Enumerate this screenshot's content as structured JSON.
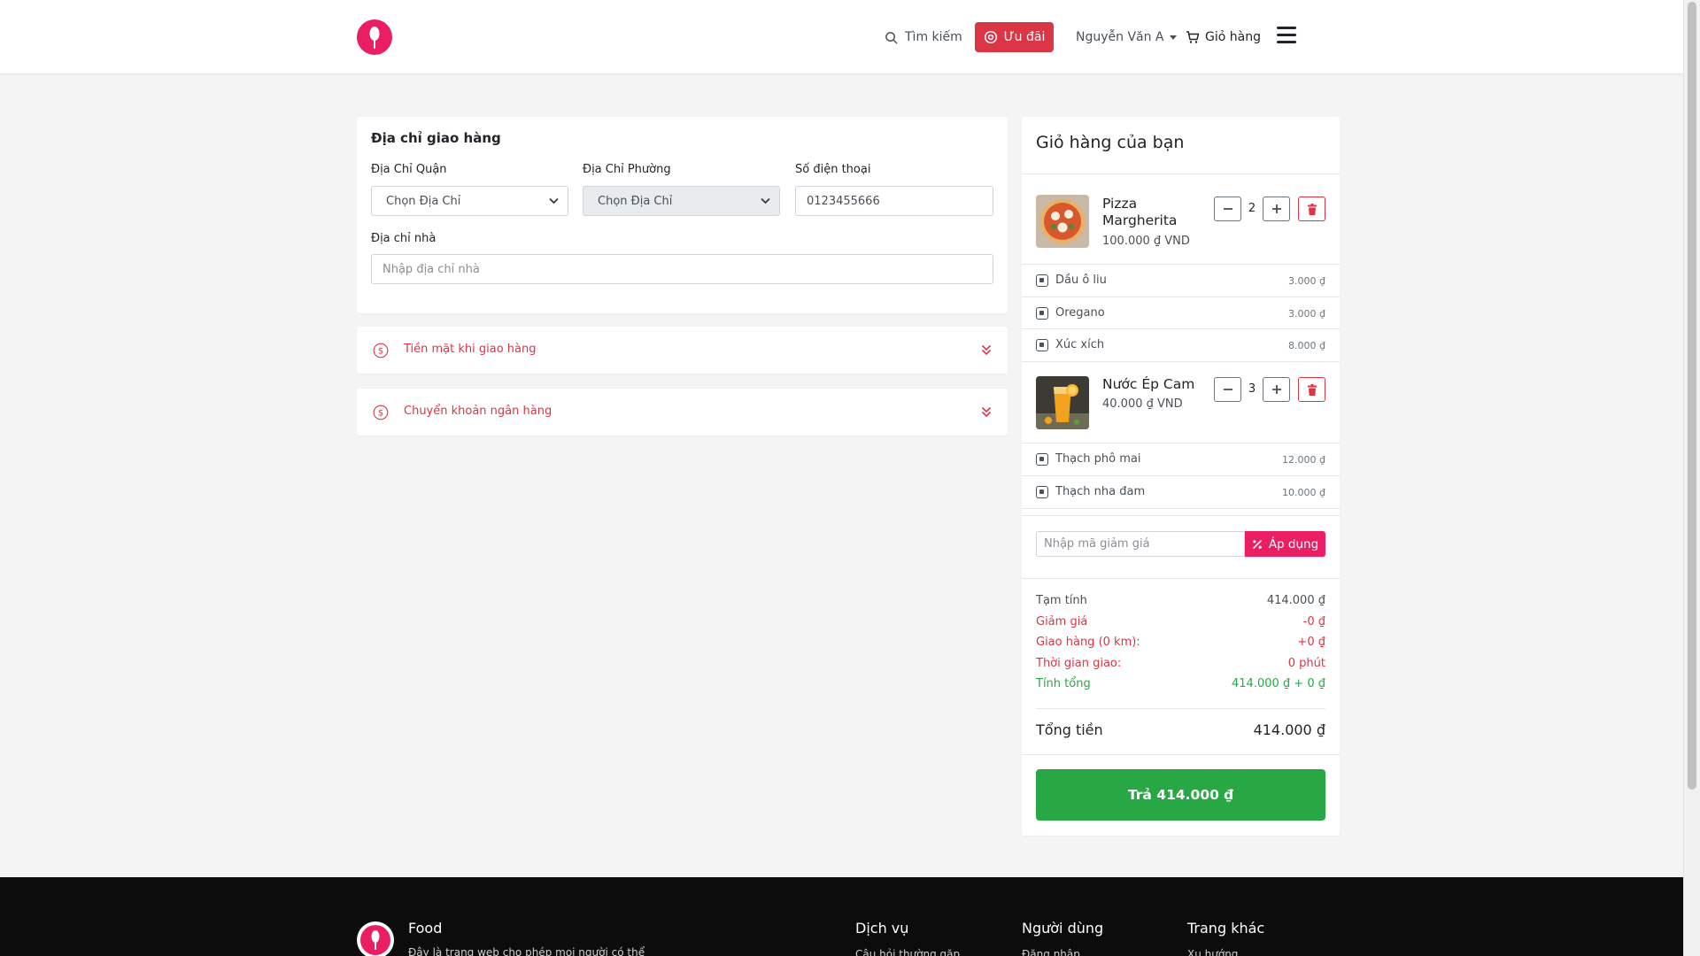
{
  "header": {
    "search_label": "Tìm kiếm",
    "promo_label": "Ưu đãi",
    "user_label": "Nguyễn Văn A",
    "cart_label": "Giỏ hàng"
  },
  "address": {
    "title": "Địa chỉ giao hàng",
    "district_label": "Địa Chỉ Quận",
    "district_value": "Chọn Địa Chỉ",
    "ward_label": "Địa Chỉ Phường",
    "ward_value": "Chọn Địa Chỉ",
    "phone_label": "Số điện thoại",
    "phone_value": "0123455666",
    "home_label": "Địa chỉ nhà",
    "home_placeholder": "Nhập địa chỉ nhà"
  },
  "payment": {
    "cash_label": "Tiền mặt khi giao hàng",
    "bank_label": "Chuyển khoản ngân hàng"
  },
  "cart": {
    "title": "Giỏ hàng của bạn",
    "items": [
      {
        "name": "Pizza Margherita",
        "price": "100.000 ₫ VND",
        "qty": "2",
        "toppings": [
          {
            "name": "Dầu ô liu",
            "price": "3.000 ₫"
          },
          {
            "name": "Oregano",
            "price": "3.000 ₫"
          },
          {
            "name": "Xúc xích",
            "price": "8.000 ₫"
          }
        ]
      },
      {
        "name": "Nước Ép Cam",
        "price": "40.000 ₫ VND",
        "qty": "3",
        "toppings": [
          {
            "name": "Thạch phô mai",
            "price": "12.000 ₫"
          },
          {
            "name": "Thạch nha đam",
            "price": "10.000 ₫"
          }
        ]
      }
    ],
    "coupon_placeholder": "Nhập mã giảm giá",
    "apply_label": "Áp dụng",
    "summary": {
      "subtotal_label": "Tạm tính",
      "subtotal_value": "414.000 ₫",
      "discount_label": "Giảm giá",
      "discount_value": "-0 ₫",
      "shipping_label": "Giao hàng (0 km):",
      "shipping_value": "+0 ₫",
      "time_label": "Thời gian giao:",
      "time_value": "0 phút",
      "calc_label": "Tính tổng",
      "calc_value": "414.000 ₫ + 0 ₫"
    },
    "total_label": "Tổng tiền",
    "total_value": "414.000 ₫",
    "pay_button": "Trả 414.000 ₫"
  },
  "footer": {
    "brand": "Food",
    "description": "Đây là trang web cho phép mọi người có thể",
    "col1_title": "Dịch vụ",
    "col1_link": "Câu hỏi thường gặp",
    "col2_title": "Người dùng",
    "col2_link": "Đăng nhập",
    "col3_title": "Trang khác",
    "col3_link": "Xu hướng"
  },
  "colors": {
    "brand": "#e91e63",
    "danger": "#dc3545",
    "success": "#28a745"
  },
  "icons": [
    "logo-icon",
    "search-icon",
    "promo-icon",
    "cart-icon",
    "menu-icon",
    "chevron-down-icon",
    "dollar-circle-icon",
    "double-chevron-down-icon",
    "minus-icon",
    "plus-icon",
    "trash-icon",
    "checkbox-icon",
    "percent-icon"
  ]
}
